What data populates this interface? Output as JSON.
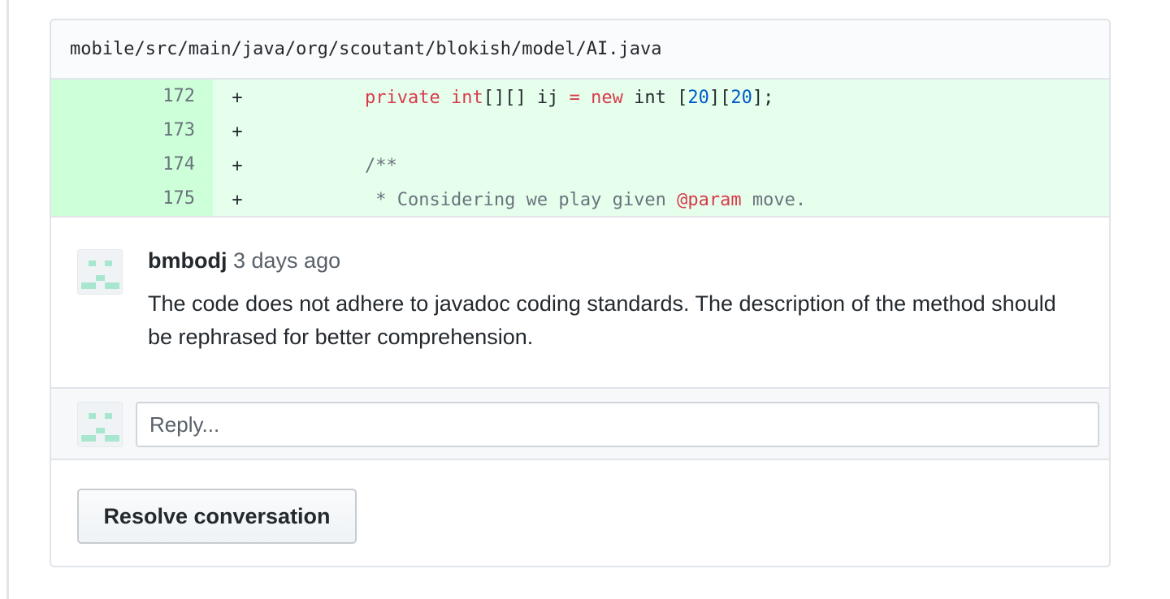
{
  "file": {
    "path": "mobile/src/main/java/org/scoutant/blokish/model/AI.java"
  },
  "diff": {
    "marker": "+",
    "lines": [
      {
        "num": "172",
        "tokens": [
          {
            "t": "    ",
            "c": ""
          },
          {
            "t": "private",
            "c": "kw"
          },
          {
            "t": " ",
            "c": ""
          },
          {
            "t": "int",
            "c": "kw"
          },
          {
            "t": "[][] ij ",
            "c": ""
          },
          {
            "t": "=",
            "c": "kw"
          },
          {
            "t": " ",
            "c": ""
          },
          {
            "t": "new",
            "c": "kw"
          },
          {
            "t": " int [",
            "c": ""
          },
          {
            "t": "20",
            "c": "num-lit"
          },
          {
            "t": "][",
            "c": ""
          },
          {
            "t": "20",
            "c": "num-lit"
          },
          {
            "t": "];",
            "c": ""
          }
        ]
      },
      {
        "num": "173",
        "tokens": []
      },
      {
        "num": "174",
        "tokens": [
          {
            "t": "    ",
            "c": ""
          },
          {
            "t": "/**",
            "c": "cmt"
          }
        ]
      },
      {
        "num": "175",
        "tokens": [
          {
            "t": "     ",
            "c": ""
          },
          {
            "t": "* Considering we play given ",
            "c": "cmt"
          },
          {
            "t": "@param",
            "c": "kw"
          },
          {
            "t": " move.",
            "c": "cmt"
          }
        ]
      }
    ]
  },
  "comment": {
    "author": "bmbodj",
    "time": "3 days ago",
    "body": "The code does not adhere to javadoc coding standards. The description of the method should be rephrased for better comprehension."
  },
  "reply": {
    "placeholder": "Reply..."
  },
  "resolve": {
    "label": "Resolve conversation"
  }
}
